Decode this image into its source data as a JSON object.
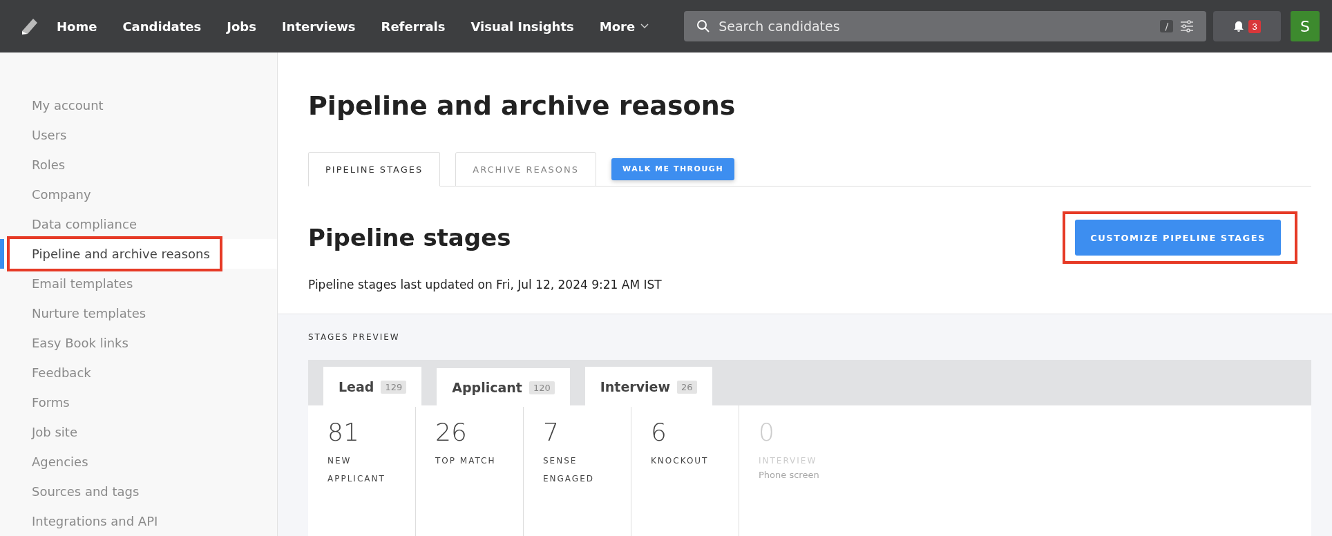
{
  "nav": {
    "items": [
      {
        "label": "Home",
        "dropdown": false
      },
      {
        "label": "Candidates",
        "dropdown": false
      },
      {
        "label": "Jobs",
        "dropdown": false
      },
      {
        "label": "Interviews",
        "dropdown": false
      },
      {
        "label": "Referrals",
        "dropdown": false
      },
      {
        "label": "Visual Insights",
        "dropdown": false
      },
      {
        "label": "More",
        "dropdown": true
      }
    ],
    "search": {
      "placeholder": "Search candidates",
      "shortcut": "/"
    },
    "notifications": {
      "count": "3"
    },
    "avatar": {
      "initial": "S"
    }
  },
  "sidebar": {
    "items": [
      {
        "label": "My account",
        "selected": false
      },
      {
        "label": "Users",
        "selected": false
      },
      {
        "label": "Roles",
        "selected": false
      },
      {
        "label": "Company",
        "selected": false
      },
      {
        "label": "Data compliance",
        "selected": false
      },
      {
        "label": "Pipeline and archive reasons",
        "selected": true,
        "highlighted": true
      },
      {
        "label": "Email templates",
        "selected": false
      },
      {
        "label": "Nurture templates",
        "selected": false
      },
      {
        "label": "Easy Book links",
        "selected": false
      },
      {
        "label": "Feedback",
        "selected": false
      },
      {
        "label": "Forms",
        "selected": false
      },
      {
        "label": "Job site",
        "selected": false
      },
      {
        "label": "Agencies",
        "selected": false
      },
      {
        "label": "Sources and tags",
        "selected": false
      },
      {
        "label": "Integrations and API",
        "selected": false
      }
    ]
  },
  "page": {
    "title": "Pipeline and archive reasons",
    "tabs": [
      {
        "label": "PIPELINE STAGES",
        "selected": true
      },
      {
        "label": "ARCHIVE REASONS",
        "selected": false
      }
    ],
    "walkthrough_button": "WALK ME THROUGH",
    "section_title": "Pipeline stages",
    "customize_button": {
      "label": "CUSTOMIZE PIPELINE STAGES",
      "highlighted": true
    },
    "updated_text": "Pipeline stages last updated on Fri, Jul 12, 2024 9:21 AM IST"
  },
  "preview": {
    "label": "STAGES PREVIEW",
    "tabs": [
      {
        "label": "Lead",
        "count": "129",
        "selected": false
      },
      {
        "label": "Applicant",
        "count": "120",
        "selected": true
      },
      {
        "label": "Interview",
        "count": "26",
        "selected": false
      }
    ],
    "stages": [
      {
        "count": "81",
        "name": "NEW APPLICANT",
        "muted": false
      },
      {
        "count": "26",
        "name": "TOP MATCH",
        "muted": false
      },
      {
        "count": "7",
        "name": "SENSE ENGAGED",
        "muted": false
      },
      {
        "count": "6",
        "name": "KNOCKOUT",
        "muted": false
      },
      {
        "count": "0",
        "name": "INTERVIEW",
        "sub": "Phone screen",
        "muted": true
      }
    ]
  }
}
